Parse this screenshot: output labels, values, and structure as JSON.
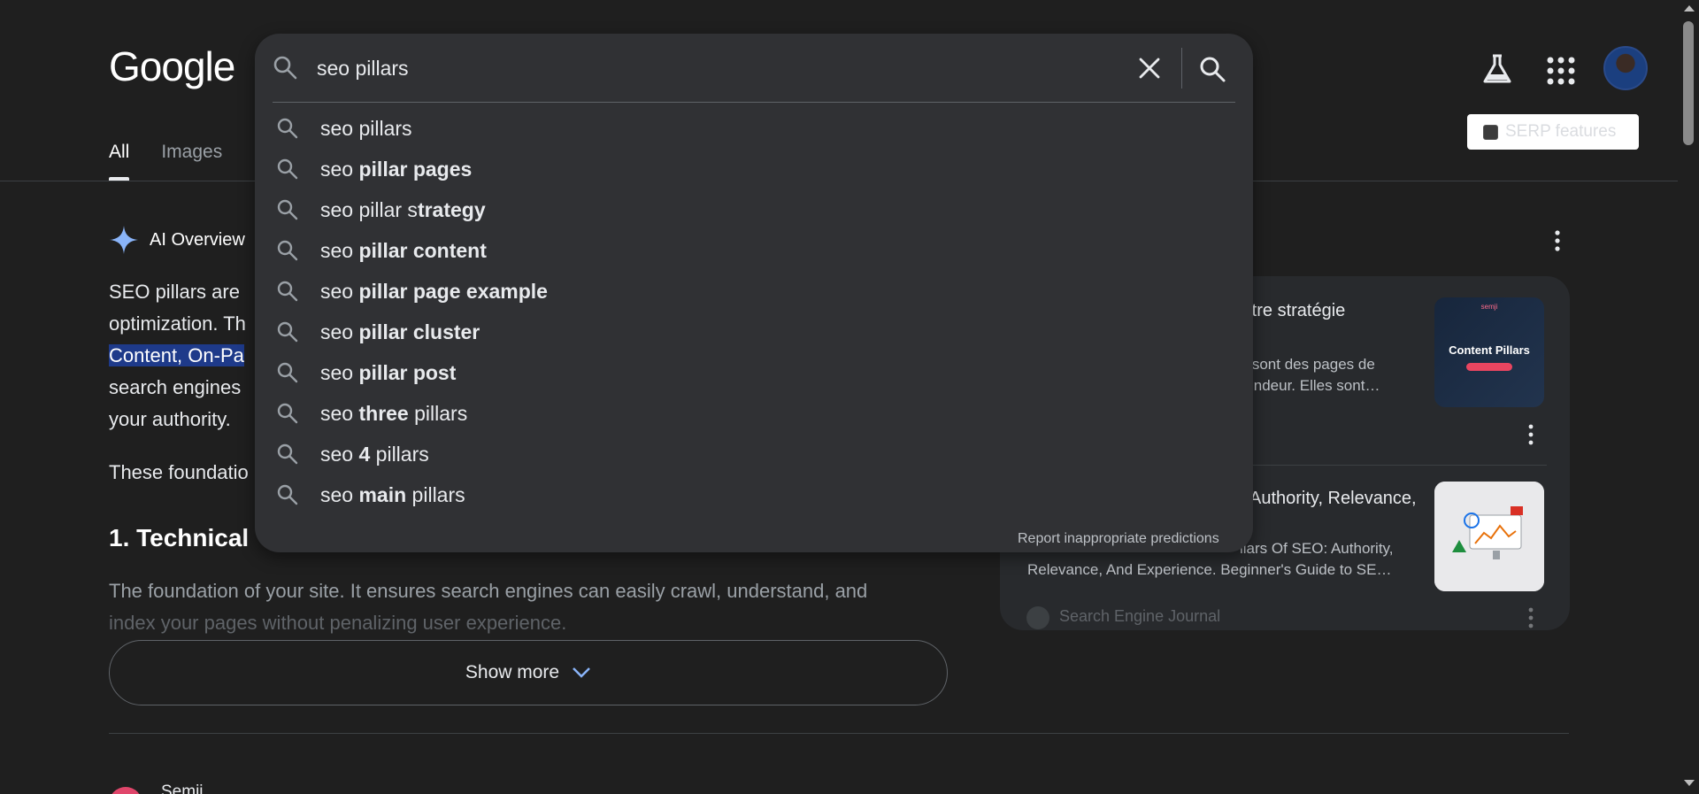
{
  "header": {
    "logo": "Google",
    "tabs": [
      {
        "label": "All",
        "active": true
      },
      {
        "label": "Images",
        "active": false
      }
    ],
    "serp_features_label": "SERP features"
  },
  "search": {
    "query": "seo pillars",
    "suggestions": [
      {
        "prefix": "seo pillars",
        "bold": "",
        "suffix": ""
      },
      {
        "prefix": "seo ",
        "bold": "pillar pages",
        "suffix": ""
      },
      {
        "prefix": "seo pillar s",
        "bold": "trategy",
        "suffix": ""
      },
      {
        "prefix": "seo ",
        "bold": "pillar content",
        "suffix": ""
      },
      {
        "prefix": "seo ",
        "bold": "pillar page example",
        "suffix": ""
      },
      {
        "prefix": "seo ",
        "bold": "pillar cluster",
        "suffix": ""
      },
      {
        "prefix": "seo ",
        "bold": "pillar post",
        "suffix": ""
      },
      {
        "prefix": "seo ",
        "bold": "three",
        "suffix": " pillars"
      },
      {
        "prefix": "seo ",
        "bold": "4",
        "suffix": " pillars"
      },
      {
        "prefix": "seo ",
        "bold": "main",
        "suffix": " pillars"
      }
    ],
    "report_label": "Report inappropriate predictions"
  },
  "ai_overview": {
    "heading": "AI Overview",
    "lines": [
      "SEO pillars are",
      "optimization. Th",
      "Content, On-Pa",
      "search engines",
      "your authority."
    ],
    "foundation_line": "These foundatio",
    "section_heading": "1. Technical",
    "section_text": "The foundation of your site. It ensures search engines can easily crawl, understand, and",
    "section_text_2": "index your pages without penalizing user experience.",
    "show_more_label": "Show more"
  },
  "sources": [
    {
      "title": "z votre stratégie",
      "snippet_1": "es » sont des pages de",
      "snippet_2": "profondeur. Elles sont…",
      "thumb_brand": "semji",
      "thumb_title": "Content Pillars"
    },
    {
      "title": "Authority, Relevance,",
      "snippet_1": "llars Of SEO: Authority,",
      "snippet_2": "Relevance, And Experience. Beginner's Guide to SE…",
      "site": "Search Engine Journal"
    }
  ],
  "result": {
    "site_name": "Semji"
  },
  "colors": {
    "background": "#1f1f1f",
    "dropdown": "#303134",
    "highlight": "#1e3a8a",
    "accent_star": "#8ab4f8"
  }
}
